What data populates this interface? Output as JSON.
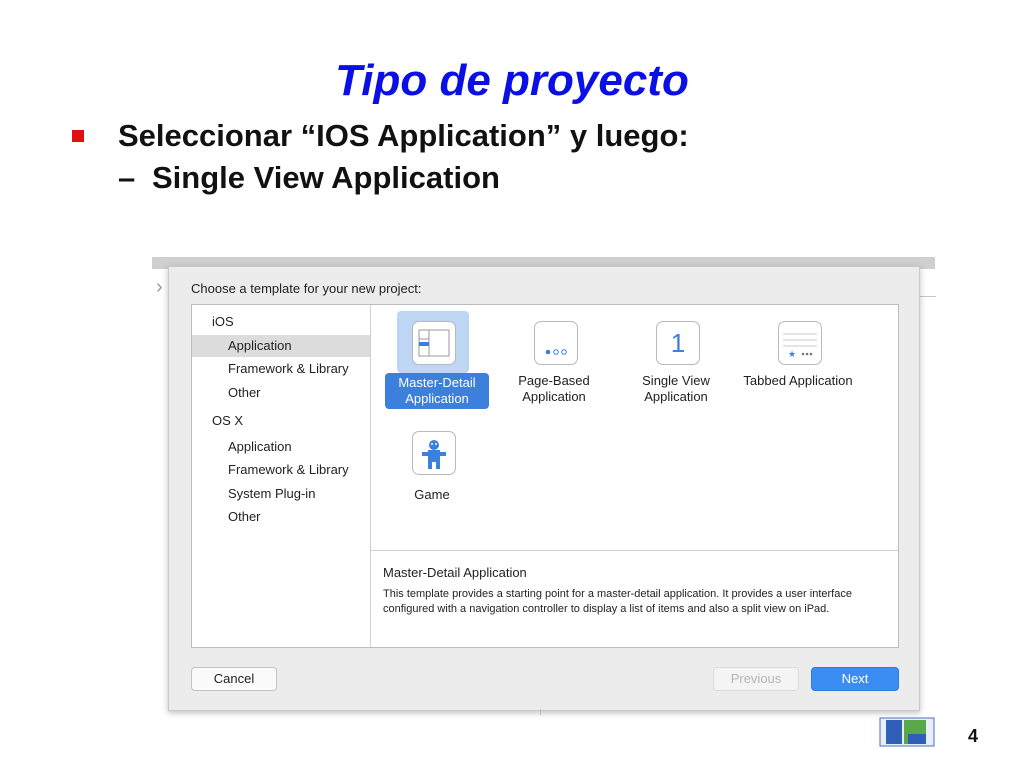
{
  "slide": {
    "title": "Tipo de proyecto",
    "line1": "Seleccionar “IOS Application” y luego:",
    "line2_dash": "–",
    "line2": "Single View Application",
    "page_number": "4"
  },
  "dialog": {
    "heading": "Choose a template for your new project:",
    "sidebar": [
      {
        "label": "iOS",
        "level": 0
      },
      {
        "label": "Application",
        "level": 1,
        "selected": true
      },
      {
        "label": "Framework & Library",
        "level": 1
      },
      {
        "label": "Other",
        "level": 1
      },
      {
        "label": "OS X",
        "level": 0
      },
      {
        "label": "Application",
        "level": 1
      },
      {
        "label": "Framework & Library",
        "level": 1
      },
      {
        "label": "System Plug-in",
        "level": 1
      },
      {
        "label": "Other",
        "level": 1
      }
    ],
    "templates": [
      {
        "label": "Master-Detail Application",
        "icon": "master-detail-icon",
        "selected": true
      },
      {
        "label": "Page-Based Application",
        "icon": "page-based-icon"
      },
      {
        "label": "Single View Application",
        "icon": "single-view-icon",
        "glyph": "1"
      },
      {
        "label": "Tabbed Application",
        "icon": "tabbed-icon"
      },
      {
        "label": "Game",
        "icon": "game-icon"
      }
    ],
    "description": {
      "title": "Master-Detail Application",
      "body": "This template provides a starting point for a master-detail application. It provides a user interface configured with a navigation controller to display a list of items and also a split view on iPad."
    },
    "buttons": {
      "cancel": "Cancel",
      "previous": "Previous",
      "next": "Next"
    }
  },
  "colors": {
    "title": "#0a0fe6",
    "bullet": "#e01010",
    "selection": "#3d7fdd",
    "next_button": "#3b8cf3"
  }
}
